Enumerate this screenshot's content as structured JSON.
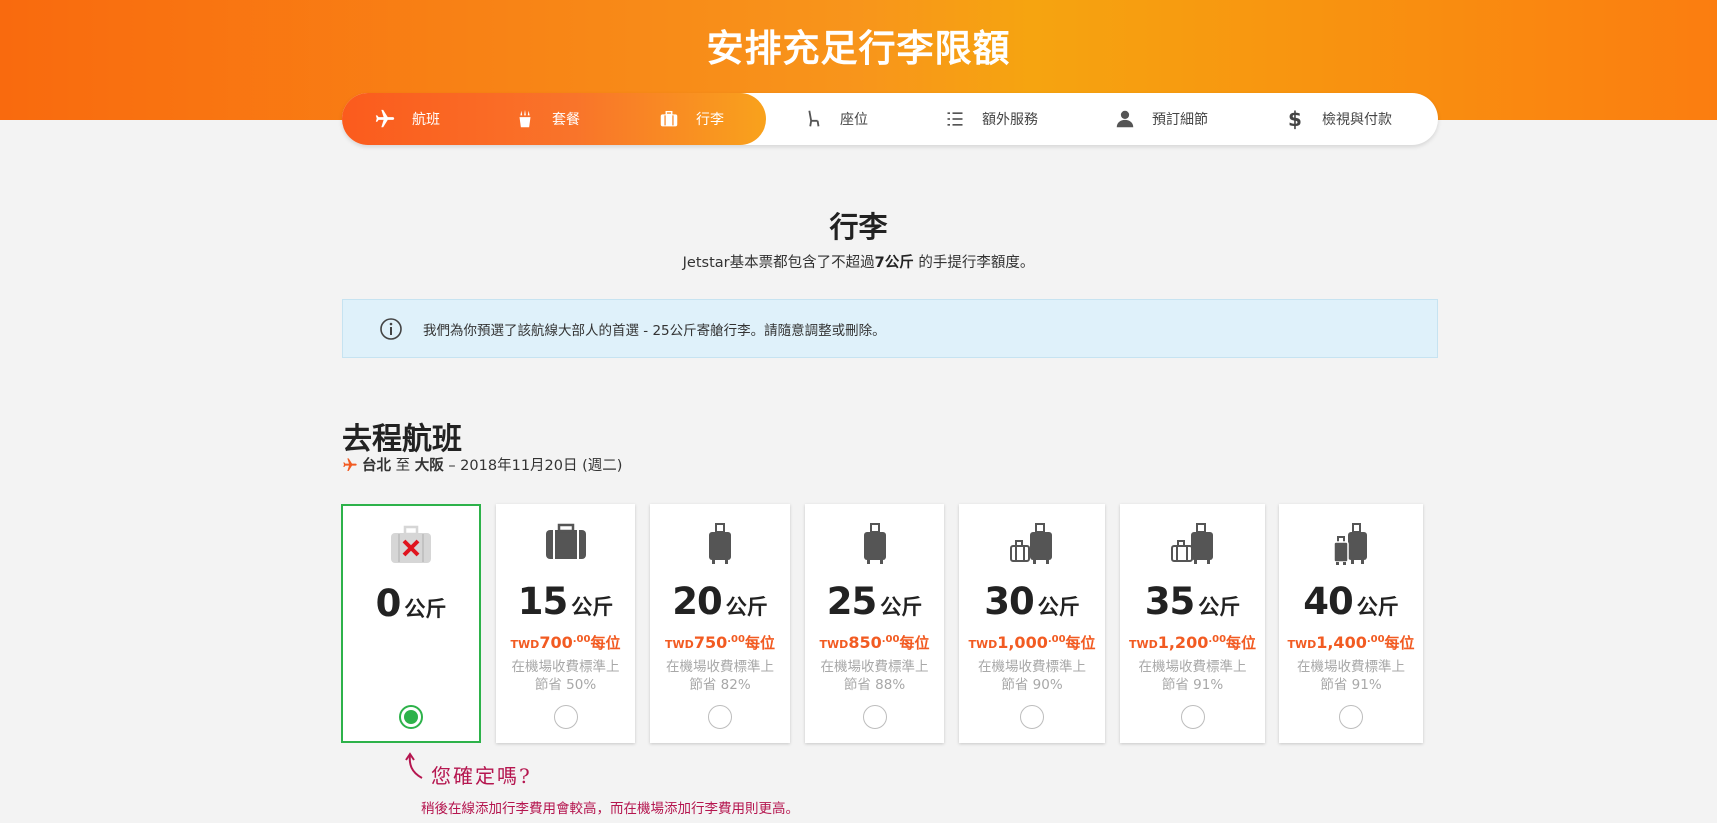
{
  "hero": {
    "title": "安排充足行李限額"
  },
  "steps": [
    {
      "label": "航班",
      "icon": "plane-icon",
      "active": true
    },
    {
      "label": "套餐",
      "icon": "meal-icon",
      "active": true
    },
    {
      "label": "行李",
      "icon": "suitcase-icon",
      "active": true
    },
    {
      "label": "座位",
      "icon": "seat-icon",
      "active": false
    },
    {
      "label": "額外服務",
      "icon": "list-icon",
      "active": false
    },
    {
      "label": "預訂細節",
      "icon": "person-icon",
      "active": false
    },
    {
      "label": "檢視與付款",
      "icon": "dollar-icon",
      "active": false
    }
  ],
  "section": {
    "title": "行李",
    "subtitle_pre": "Jetstar基本票都包含了不超過",
    "subtitle_bold": "7公斤",
    "subtitle_post": " 的手提行李額度。"
  },
  "info": {
    "text": "我們為你預選了該航線大部人的首選 - 25公斤寄艙行李。請隨意調整或刪除。",
    "icon": "info-icon"
  },
  "flight": {
    "title": "去程航班",
    "origin": "台北",
    "connector": "至",
    "destination": "大阪",
    "date": "– 2018年11月20日 (週二)"
  },
  "unit": "公斤",
  "currency": "TWD",
  "per": "每位",
  "save_prefix": "在機場收費標準上",
  "options": [
    {
      "weight": "0",
      "price": "",
      "cents": "",
      "save": "",
      "selected": true,
      "icon": "no-baggage-icon"
    },
    {
      "weight": "15",
      "price": "700",
      "cents": ".00",
      "save": "節省 50%",
      "selected": false,
      "icon": "duffel-bag-icon"
    },
    {
      "weight": "20",
      "price": "750",
      "cents": ".00",
      "save": "節省 82%",
      "selected": false,
      "icon": "suitcase-icon"
    },
    {
      "weight": "25",
      "price": "850",
      "cents": ".00",
      "save": "節省 88%",
      "selected": false,
      "icon": "suitcase-icon"
    },
    {
      "weight": "30",
      "price": "1,000",
      "cents": ".00",
      "save": "節省 90%",
      "selected": false,
      "icon": "two-suitcases-icon"
    },
    {
      "weight": "35",
      "price": "1,200",
      "cents": ".00",
      "save": "節省 91%",
      "selected": false,
      "icon": "two-suitcases-icon"
    },
    {
      "weight": "40",
      "price": "1,400",
      "cents": ".00",
      "save": "節省 91%",
      "selected": false,
      "icon": "two-suitcases-icon"
    }
  ],
  "confirm": {
    "text": "您確定嗎?",
    "note": "稍後在線添加行李費用會較高，而在機場添加行李費用則更高。"
  },
  "colors": {
    "orange": "#f96a0e",
    "price": "#f25b22",
    "selected": "#2db24a",
    "warning": "#b5164f",
    "info_bg": "#dff1fa"
  }
}
